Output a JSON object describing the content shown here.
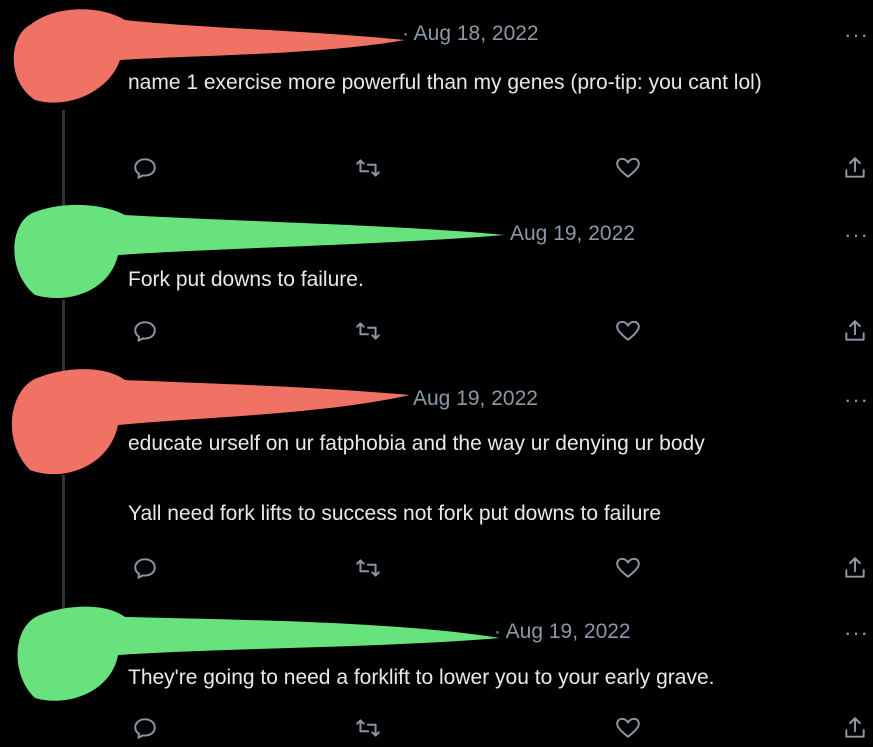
{
  "tweets": [
    {
      "date": "· Aug 18, 2022",
      "text": "name 1 exercise more powerful than my genes (pro-tip: you cant lol)",
      "redaction_color": "#f07265"
    },
    {
      "date": "Aug 19, 2022",
      "text": "Fork put downs to failure.",
      "redaction_color": "#67e27d"
    },
    {
      "date": "Aug 19, 2022",
      "text": "educate urself on ur fatphobia and the way ur denying ur body",
      "text2": "Yall need fork lifts to success not fork put downs to failure",
      "redaction_color": "#f07265"
    },
    {
      "date": "· Aug 19, 2022",
      "text": "They're going to need a forklift to lower you to your early grave.",
      "redaction_color": "#67e27d"
    }
  ],
  "more_label": "···",
  "icons": {
    "reply": "reply-icon",
    "retweet": "retweet-icon",
    "like": "heart-icon",
    "share": "share-icon"
  }
}
